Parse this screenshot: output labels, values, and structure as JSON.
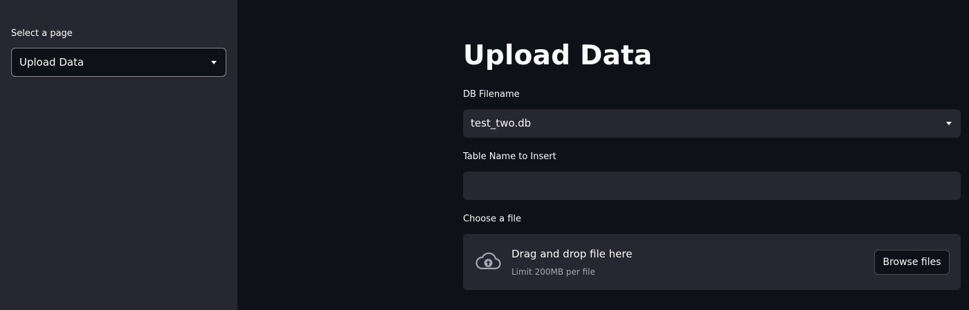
{
  "sidebar": {
    "select_label": "Select a page",
    "selected_page": "Upload Data"
  },
  "main": {
    "title": "Upload Data",
    "db_filename": {
      "label": "DB Filename",
      "value": "test_two.db"
    },
    "table_name": {
      "label": "Table Name to Insert",
      "value": ""
    },
    "file_upload": {
      "label": "Choose a file",
      "drop_text": "Drag and drop file here",
      "limit_text": "Limit 200MB per file",
      "browse_label": "Browse files",
      "icon": "cloud-upload-icon"
    }
  },
  "colors": {
    "main_background": "#0e1117",
    "sidebar_background": "#262730",
    "widget_background": "#262730",
    "text": "#fafafa",
    "muted_text": "#a3a8b4"
  }
}
